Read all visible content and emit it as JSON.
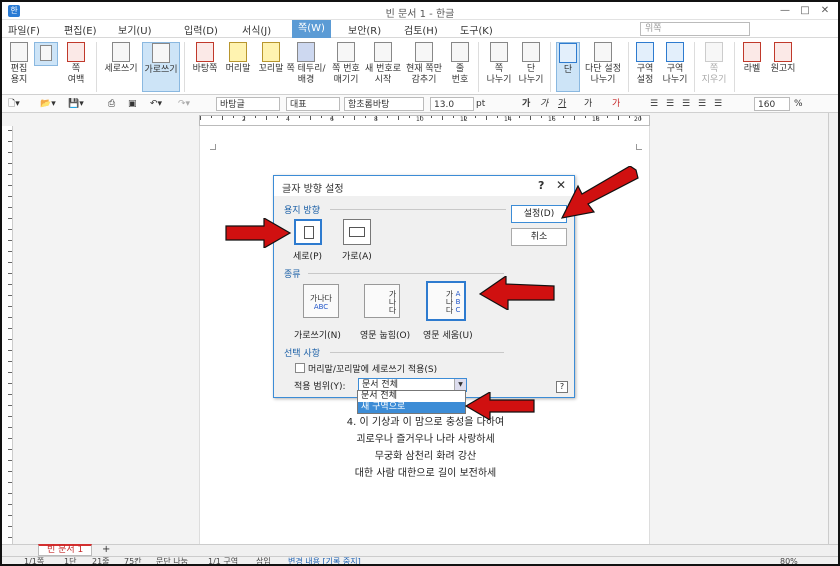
{
  "window": {
    "title": "빈 문서 1 - 한글",
    "app_icon": "한"
  },
  "menu": [
    {
      "label": "파일(F)"
    },
    {
      "label": "편집(E)"
    },
    {
      "label": "보기(U)"
    },
    {
      "label": "입력(D)"
    },
    {
      "label": "서식(J)"
    },
    {
      "label": "쪽(W)"
    },
    {
      "label": "보안(R)"
    },
    {
      "label": "검토(H)"
    },
    {
      "label": "도구(K)"
    }
  ],
  "menu_active": "쪽(W)",
  "search": {
    "placeholder": "위쪽"
  },
  "ribbon": [
    {
      "l1": "편집",
      "l2": "용지"
    },
    {
      "l1": "쪽",
      "l2": "여백"
    },
    {
      "l1": "세로쓰기",
      "l2": ""
    },
    {
      "l1": "가로쓰기",
      "l2": ""
    },
    {
      "l1": "바탕쪽",
      "l2": ""
    },
    {
      "l1": "머리말",
      "l2": ""
    },
    {
      "l1": "꼬리말",
      "l2": ""
    },
    {
      "l1": "쪽 테두리/",
      "l2": "배경"
    },
    {
      "l1": "쪽 번호",
      "l2": "매기기"
    },
    {
      "l1": "새 번호로",
      "l2": "시작"
    },
    {
      "l1": "현재 쪽만",
      "l2": "감추기"
    },
    {
      "l1": "줄",
      "l2": "번호"
    },
    {
      "l1": "쪽",
      "l2": "나누기"
    },
    {
      "l1": "단",
      "l2": "나누기"
    },
    {
      "l1": "단",
      "l2": ""
    },
    {
      "l1": "다단 설정",
      "l2": "나누기"
    },
    {
      "l1": "구역",
      "l2": "설정"
    },
    {
      "l1": "구역",
      "l2": "나누기"
    },
    {
      "l1": "쪽",
      "l2": "지우기"
    },
    {
      "l1": "라벨",
      "l2": ""
    },
    {
      "l1": "원고지",
      "l2": ""
    }
  ],
  "toolbar2": {
    "style": "바탕글",
    "lang": "대표",
    "font": "함초롬바탕",
    "size": "13.0",
    "unit": "pt",
    "fmt": [
      "가",
      "가",
      "가",
      "가",
      "가"
    ],
    "zoom": "160",
    "zoom_unit": "%"
  },
  "ruler_numbers": [
    "2",
    "4",
    "6",
    "8",
    "10",
    "12",
    "14",
    "16",
    "18",
    "20"
  ],
  "dialog": {
    "title": "글자 방향 설정",
    "help": "?",
    "close": "✕",
    "sec_paper": "용지 방향",
    "portrait": "세로(P)",
    "landscape": "가로(A)",
    "sec_kind": "종류",
    "kind1_glyph": "가나다",
    "kind1_abc": "ABC",
    "kind1": "가로쓰기(N)",
    "kind2_glyph": "가나다",
    "kind2": "영문 눕힘(O)",
    "kind3_glyph": "가나다",
    "kind3_abc": "ABC",
    "kind3": "영문 세움(U)",
    "sec_option": "선택 사항",
    "checkbox": "머리말/꼬리말에 세로쓰기 적용(S)",
    "scope_label": "적용 범위(Y):",
    "scope_value": "문서 전체",
    "setting": "설정(D)",
    "cancel": "취소",
    "small_help": "?"
  },
  "dropdown_options": [
    "문서 전체",
    "새 구역으로"
  ],
  "body_lines": [
    "4. 이 기상과 이 맘으로 충성을 다하여",
    "괴로우나 즐거우나 나라 사랑하세",
    "무궁화 삼천리 화려 강산",
    "대한 사람 대한으로 길이 보전하세"
  ],
  "tabs": {
    "doc": "빈 문서 1",
    "add": "+"
  },
  "status": [
    "1/1쪽",
    "1단",
    "21줄",
    "75칸",
    "문단 나눔",
    "1/1 구역",
    "삽입",
    "변경 내용 [기록 중지]",
    "80%"
  ],
  "colors": {
    "accent": "#3c8cd6",
    "arrow": "#d01010",
    "active_menu": "#5b9bd5",
    "tab_red": "#c62828"
  }
}
